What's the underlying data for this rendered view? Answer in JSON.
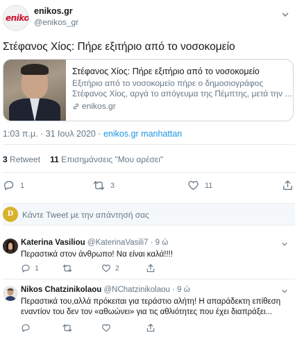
{
  "tweet": {
    "display_name": "enikos.gr",
    "handle": "@enikos_gr",
    "logo_text": "enikos",
    "text": "Στέφανος Χίος: Πήρε εξιτήριο από το νοσοκομείο",
    "card": {
      "title": "Στέφανος Χίος: Πήρε εξιτήριο από το νοσοκομείο",
      "desc_line1": "Εξιτήριο από το νοσοκομείο πήρε ο δημοσιογράφος",
      "desc_line2": "Στέφανος Χίος, αργά το απόγευμα της Πέμπτης, μετά την ...",
      "domain": "enikos.gr"
    },
    "time": "1:03 π.μ. · 31 Ιουλ 2020 · ",
    "source": "enikos.gr manhattan",
    "retweets_count": "3",
    "retweets_label": "Retweet",
    "likes_count": "11",
    "likes_label": "Επισημάνσεις \"Μου αρέσει\"",
    "actions": {
      "reply_count": "1",
      "retweet_count": "3",
      "like_count": "11"
    },
    "reply_placeholder": "Κάντε Tweet με την απάντησή σας",
    "reply_avatar_letter": "D"
  },
  "replies": [
    {
      "name": "Katerina Vasiliou",
      "handle": "@KaterinaVasili7 · 9 ώ",
      "text": "Περαστικά στον άνθρωπο! Να είναι καλά!!!!",
      "reply_count": "1",
      "retweet_count": "",
      "like_count": "2"
    },
    {
      "name": "Nikos Chatzinikolaou",
      "handle": "@NChatzinikolaou · 9 ώ",
      "text": "Περαστικά του,αλλά πρόκειται για τεράστιο αλήτη! Η απαράδεκτη επίθεση εναντίον του δεν τον «αθωώνει» για τις αθλιότητες που έχει διαπράξει...",
      "reply_count": "",
      "retweet_count": "",
      "like_count": ""
    }
  ],
  "colors": {
    "accent": "#1b95e0",
    "text": "#14171a",
    "muted": "#657786",
    "border": "#e6ecf0"
  }
}
